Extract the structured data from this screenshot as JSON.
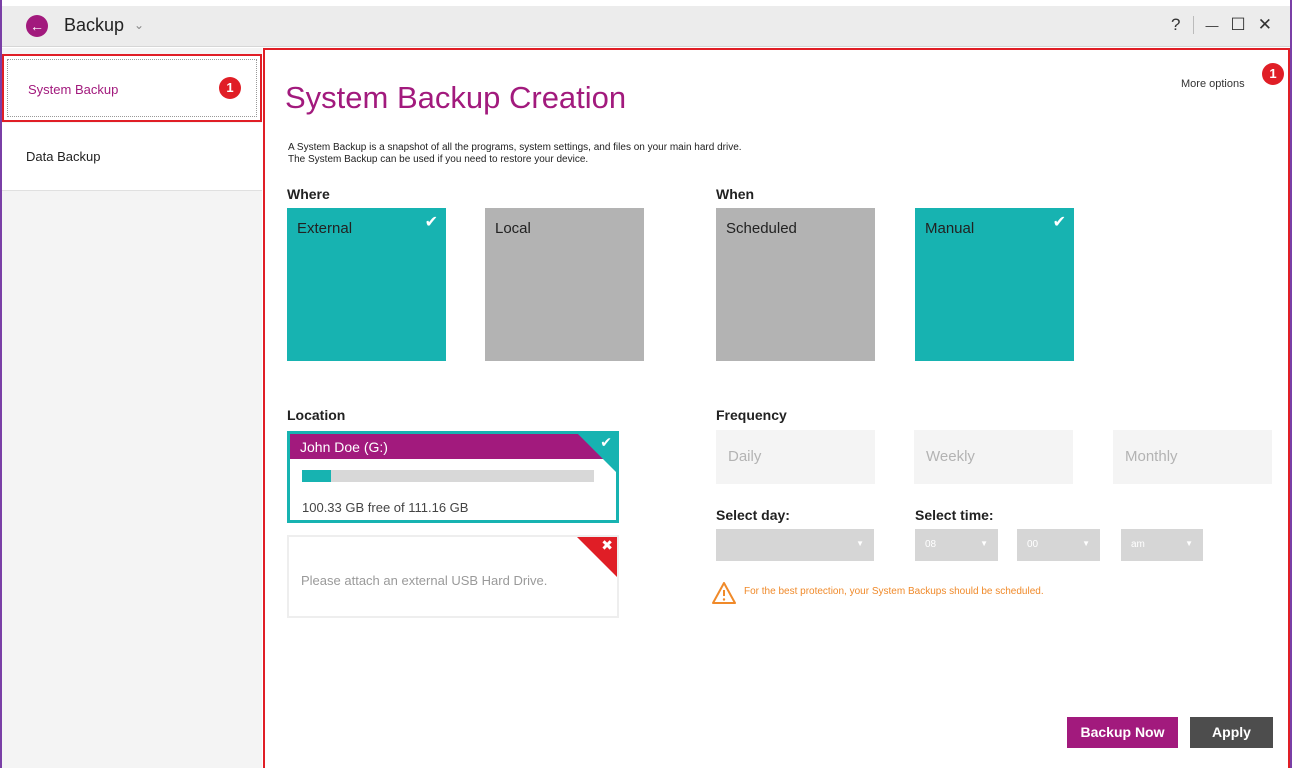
{
  "titlebar": {
    "back_icon": "arrow-left-icon",
    "title": "Backup",
    "chevron": "⌄",
    "help": "?",
    "minimize": "—",
    "maximize": "☐",
    "close": "✕"
  },
  "sidebar": {
    "items": [
      {
        "label": "System Backup",
        "active": true
      },
      {
        "label": "Data Backup",
        "active": false
      }
    ]
  },
  "callouts": {
    "sidebar": "1",
    "more_options": "1"
  },
  "main": {
    "title": "System Backup Creation",
    "more_options": "More options",
    "description": [
      "A System Backup is a snapshot of all the programs, system settings, and files on your main hard drive.",
      "The System Backup can be used if you need to restore your device."
    ],
    "where": {
      "label": "Where",
      "options": [
        {
          "label": "External",
          "selected": true
        },
        {
          "label": "Local",
          "selected": false
        }
      ]
    },
    "when": {
      "label": "When",
      "options": [
        {
          "label": "Scheduled",
          "selected": false
        },
        {
          "label": "Manual",
          "selected": true
        }
      ]
    },
    "location": {
      "label": "Location",
      "drive_name": "John Doe (G:)",
      "usage_fraction": 0.1,
      "free_text": "100.33 GB free of 111.16 GB",
      "usb_message": "Please attach an external USB Hard Drive."
    },
    "frequency": {
      "label": "Frequency",
      "options": [
        "Daily",
        "Weekly",
        "Monthly"
      ]
    },
    "select_day": {
      "label": "Select day:",
      "value": ""
    },
    "select_time": {
      "label": "Select time:",
      "hour": "08",
      "minute": "00",
      "ampm": "am"
    },
    "warning": "For the best protection, your System Backups should be scheduled.",
    "buttons": {
      "backup_now": "Backup Now",
      "apply": "Apply"
    }
  },
  "colors": {
    "brand": "#a21a7d",
    "teal": "#17b3b1",
    "tile_off": "#b3b3b3",
    "warning": "#f08a2a",
    "highlight_red": "#e01e26"
  }
}
